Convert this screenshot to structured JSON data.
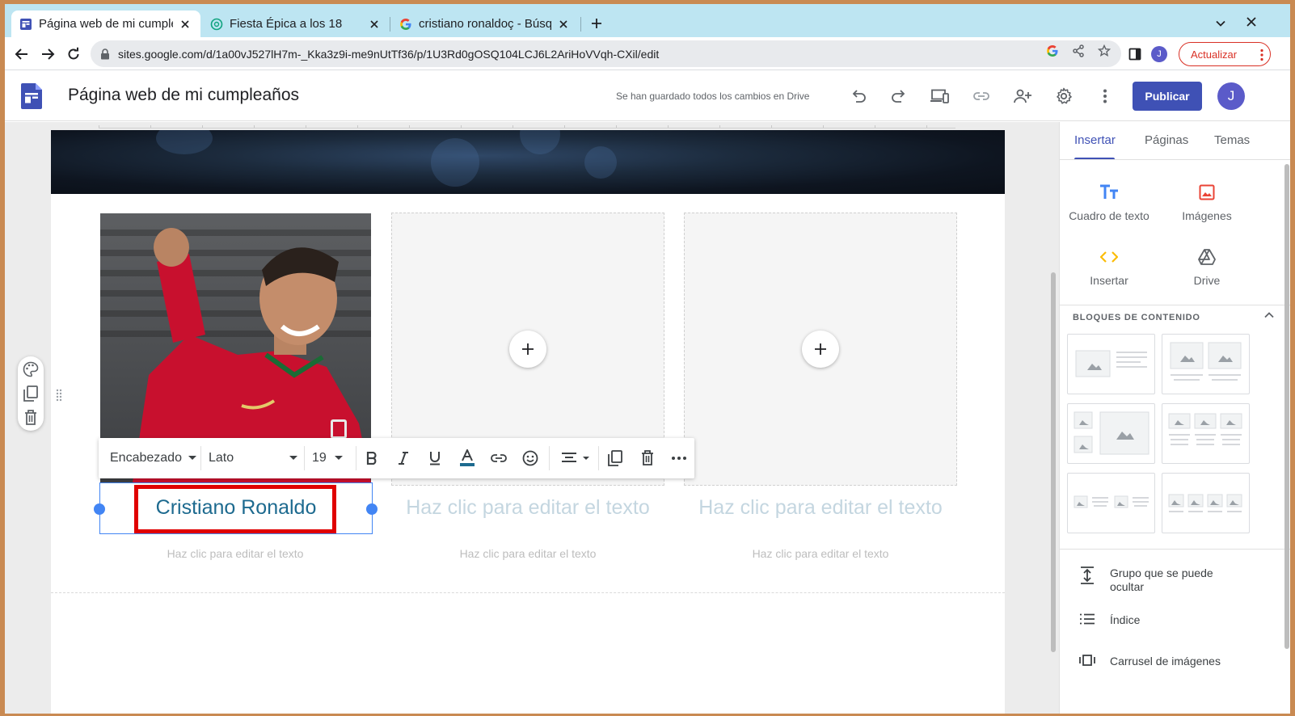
{
  "browser": {
    "tabs": [
      {
        "label": "Página web de mi cumpleaños",
        "icon": "google-sites-icon",
        "active": true
      },
      {
        "label": "Fiesta Épica a los 18",
        "icon": "chatgpt-icon",
        "active": false
      },
      {
        "label": "cristiano ronaldoç - Búsqueda de Google",
        "icon": "google-icon",
        "active": false
      }
    ],
    "url": "sites.google.com/d/1a00vJ527lH7m-_Kka3z9i-me9nUtTf36/p/1U3Rd0gOSQ104LCJ6L2AriHoVVqh-CXil/edit",
    "profile_initial": "J",
    "update_label": "Actualizar"
  },
  "app": {
    "title": "Página web de mi cumpleaños",
    "saved_status": "Se han guardado todos los cambios en Drive",
    "publish_label": "Publicar",
    "avatar_initial": "J"
  },
  "format_toolbar": {
    "style": "Encabezado",
    "font": "Lato",
    "size": "19"
  },
  "page": {
    "columns": [
      {
        "heading": "Cristiano Ronaldo",
        "subtext": "Haz clic para editar el texto",
        "has_image": true
      },
      {
        "heading": "Haz clic para editar el texto",
        "subtext": "Haz clic para editar el texto",
        "has_image": false
      },
      {
        "heading": "Haz clic para editar el texto",
        "subtext": "Haz clic para editar el texto",
        "has_image": false
      }
    ]
  },
  "panel": {
    "tabs": [
      "Insertar",
      "Páginas",
      "Temas"
    ],
    "insert_items": [
      {
        "label": "Cuadro de texto",
        "icon": "text-box-icon"
      },
      {
        "label": "Imágenes",
        "icon": "image-icon"
      },
      {
        "label": "Insertar",
        "icon": "embed-code-icon"
      },
      {
        "label": "Drive",
        "icon": "drive-icon"
      }
    ],
    "blocks_title": "BLOQUES DE CONTENIDO",
    "list_items": [
      {
        "label": "Grupo que se puede ocultar",
        "icon": "collapsible-group-icon"
      },
      {
        "label": "Índice",
        "icon": "table-of-contents-icon"
      },
      {
        "label": "Carrusel de imágenes",
        "icon": "image-carousel-icon"
      }
    ]
  },
  "colors": {
    "accent": "#3f51b5",
    "heading_text": "#1d6a8f",
    "selection": "#4285f4",
    "highlight": "#e00000",
    "tabstrip": "#bde5f2"
  }
}
